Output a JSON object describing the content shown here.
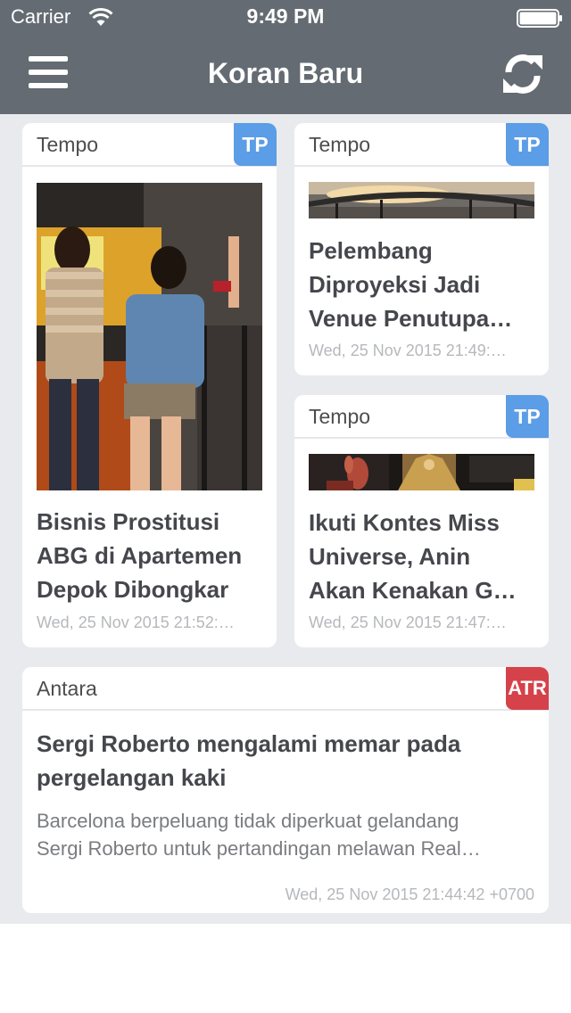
{
  "status_bar": {
    "carrier": "Carrier",
    "time": "9:49 PM"
  },
  "header": {
    "title": "Koran Baru",
    "left_icon": "menu-icon",
    "right_icon": "refresh-icon"
  },
  "colors": {
    "header_bg": "#646b72",
    "feed_bg": "#e8eaee",
    "badge_tp": "#5b9de6",
    "badge_atr": "#d5424a",
    "title_text": "#45474c",
    "date_text": "#b5b8bc"
  },
  "articles": [
    {
      "source": "Tempo",
      "badge": "TP",
      "title_lines": [
        "Bisnis Prostitusi",
        "ABG di Apartemen",
        "Depok Dibongkar"
      ],
      "date": "Wed, 25 Nov 2015 21:52:…"
    },
    {
      "source": "Tempo",
      "badge": "TP",
      "title_lines": [
        "Pelembang",
        "Diproyeksi Jadi",
        "Venue Penutupa…"
      ],
      "date": "Wed, 25 Nov 2015 21:49:…"
    },
    {
      "source": "Tempo",
      "badge": "TP",
      "title_lines": [
        "Ikuti Kontes Miss",
        "Universe, Anin",
        "Akan Kenakan G…"
      ],
      "date": "Wed, 25 Nov 2015 21:47:…"
    },
    {
      "source": "Antara",
      "badge": "ATR",
      "title_lines": [
        "Sergi Roberto mengalami memar pada",
        "pergelangan kaki"
      ],
      "summary_lines": [
        "Barcelona berpeluang tidak diperkuat gelandang",
        "Sergi Roberto untuk pertandingan melawan Real…"
      ],
      "date": "Wed, 25 Nov 2015 21:44:42 +0700"
    }
  ]
}
